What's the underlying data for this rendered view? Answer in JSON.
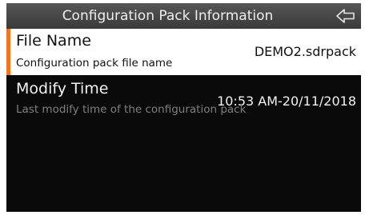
{
  "header": {
    "title": "Configuration Pack Information",
    "back_icon": "back-arrow-icon"
  },
  "colors": {
    "accent": "#ee7622",
    "header_bg": "#4a4a4a",
    "screen_bg": "#0a0a0a",
    "selected_bg": "#ffffff",
    "muted_text": "#7f7f7f"
  },
  "items": [
    {
      "title": "File Name",
      "description": "Configuration pack file name",
      "value": "DEMO2.sdrpack",
      "selected": true
    },
    {
      "title": "Modify Time",
      "description": "Last modify time of the configuration pack",
      "value": "10:53 AM-20/11/2018",
      "selected": false
    }
  ]
}
